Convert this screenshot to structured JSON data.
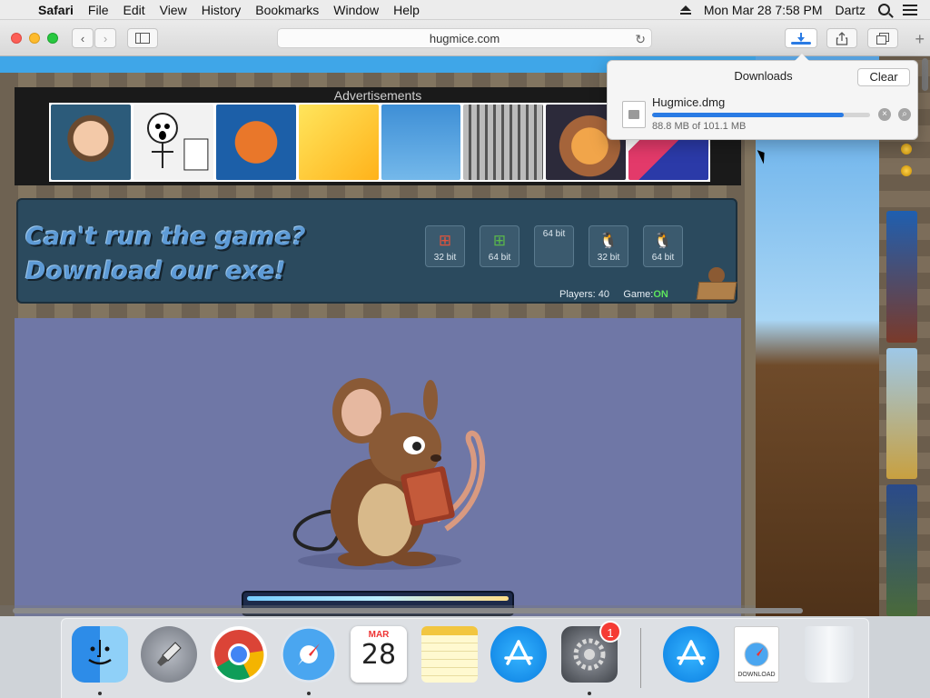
{
  "menubar": {
    "app": "Safari",
    "items": [
      "File",
      "Edit",
      "View",
      "History",
      "Bookmarks",
      "Window",
      "Help"
    ],
    "clock": "Mon Mar 28  7:58 PM",
    "user": "Dartz"
  },
  "toolbar": {
    "url": "hugmice.com"
  },
  "page": {
    "ads_title": "Advertisements",
    "download_line1": "Can't run the game?",
    "download_line2": "Download our exe!",
    "os_buttons": [
      "32 bit",
      "64 bit",
      "64 bit",
      "32 bit",
      "64 bit"
    ],
    "players_label": "Players: 40",
    "game_label": "Game:",
    "game_status": "ON"
  },
  "downloads": {
    "title": "Downloads",
    "clear_label": "Clear",
    "file_name": "Hugmice.dmg",
    "file_size": "88.8 MB of 101.1 MB",
    "progress": 0.878
  },
  "dock": {
    "calendar_month": "MAR",
    "calendar_day": "28",
    "settings_badge": "1",
    "download_doc_label": "DOWNLOAD"
  },
  "colors": {
    "accent": "#2a7be4",
    "game_on": "#5de35d"
  }
}
